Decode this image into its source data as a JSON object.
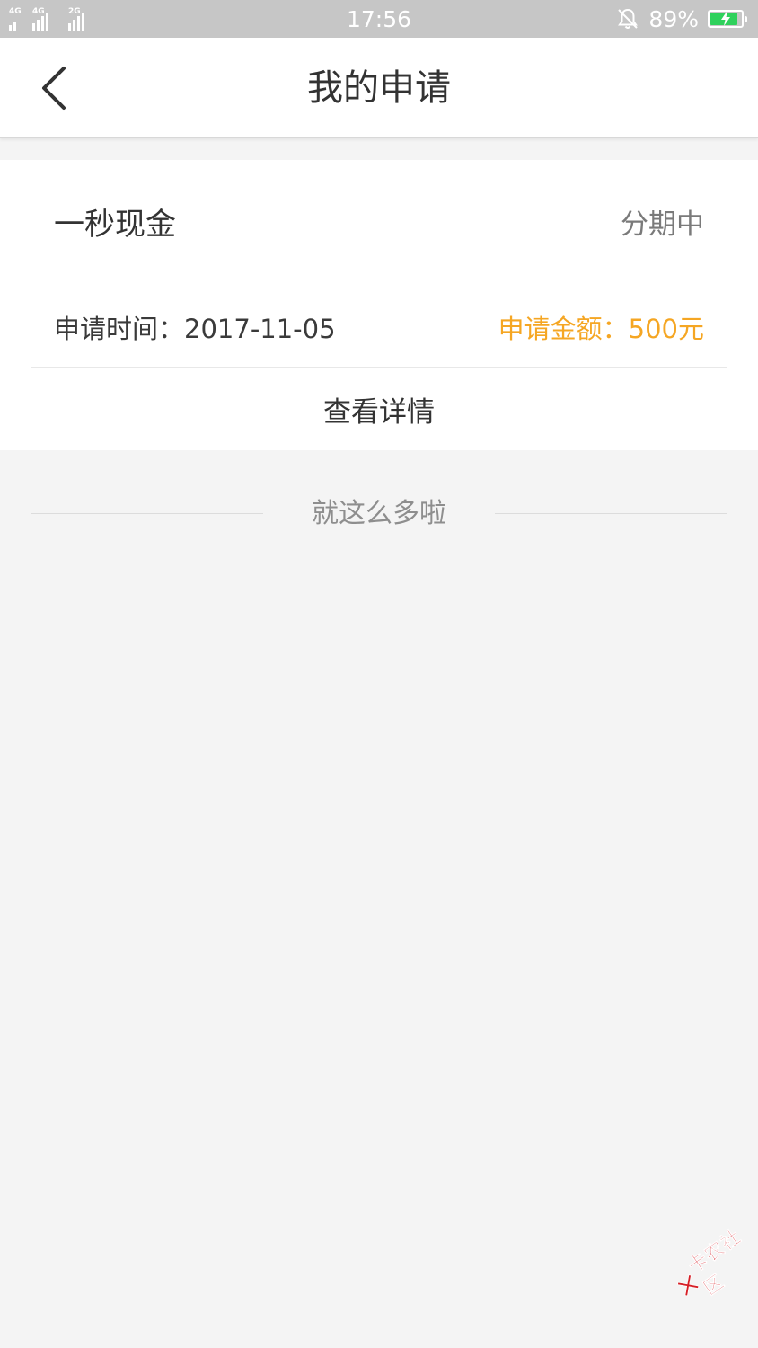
{
  "status_bar": {
    "networks": [
      "4G",
      "4G",
      "2G"
    ],
    "time": "17:56",
    "battery_percent": "89%",
    "battery_level": 0.89,
    "battery_color": "#2fd15c",
    "icons": [
      "signal-icon",
      "muted-bell-icon",
      "battery-charging-icon"
    ]
  },
  "nav": {
    "title": "我的申请",
    "back_icon": "chevron-left-icon"
  },
  "application": {
    "product_name": "一秒现金",
    "status": "分期中",
    "apply_time_label": "申请时间：",
    "apply_time": "2017-11-05",
    "apply_amount_label": "申请金额：",
    "apply_amount": "500元",
    "details_button": "查看详情",
    "amount_color": "#f5a623"
  },
  "list_end_text": "就这么多啦",
  "watermark": {
    "text": "卡农社区"
  }
}
